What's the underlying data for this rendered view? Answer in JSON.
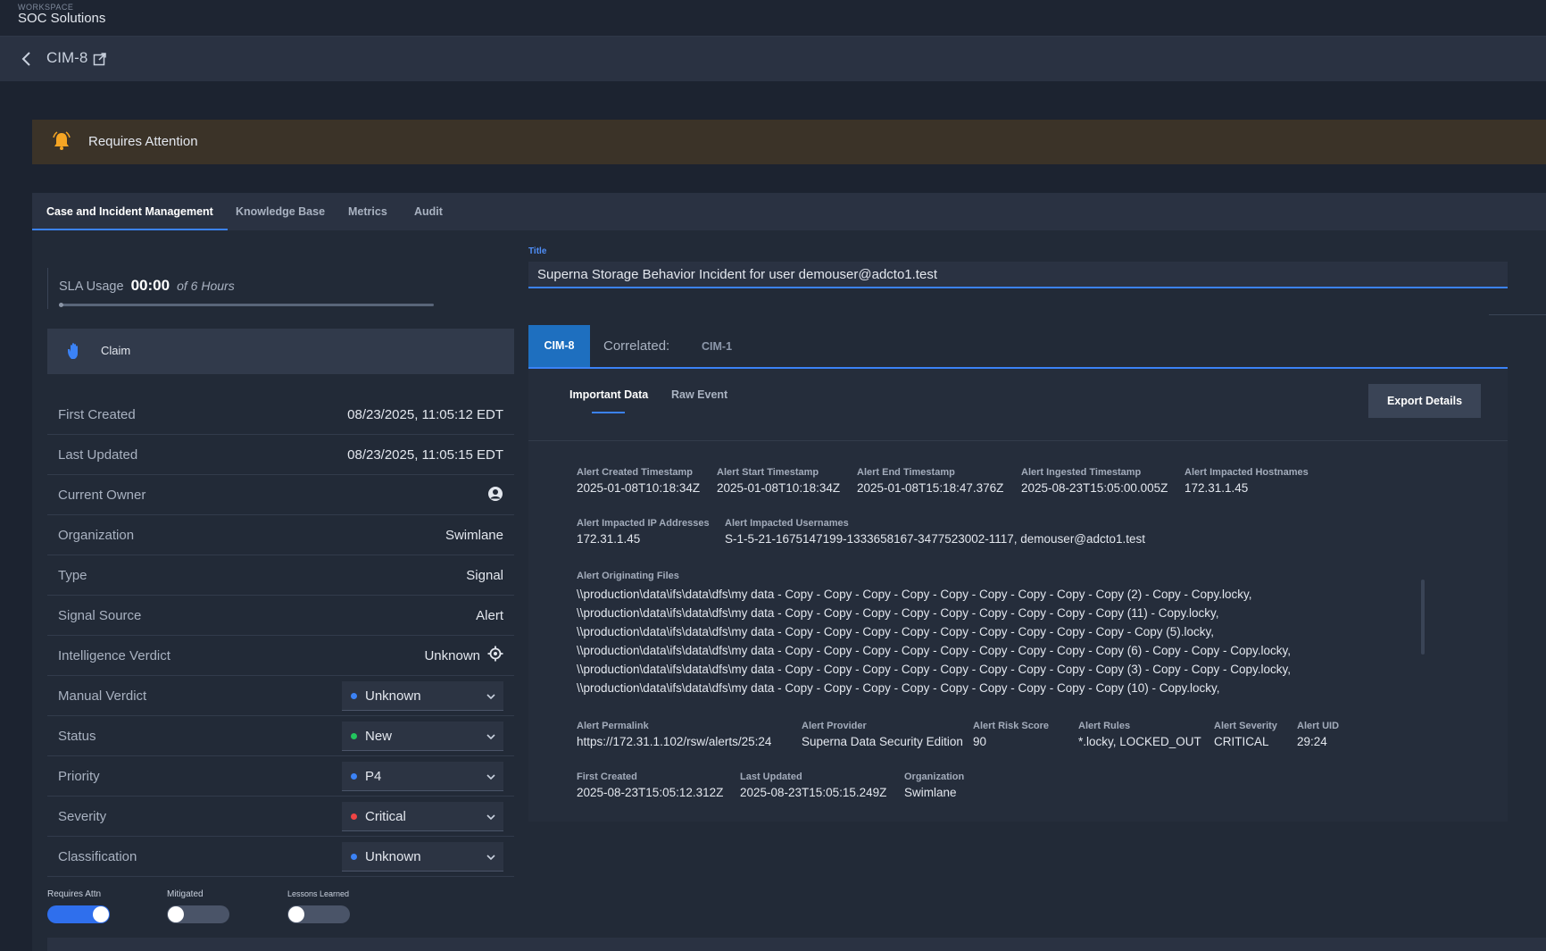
{
  "workspace": {
    "label": "WORKSPACE",
    "name": "SOC Solutions"
  },
  "case": {
    "id": "CIM-8"
  },
  "banner": {
    "text": "Requires Attention",
    "color": "#3b3328",
    "icon": "bell-icon"
  },
  "tabs": [
    {
      "label": "Case and Incident Management",
      "active": true
    },
    {
      "label": "Knowledge Base"
    },
    {
      "label": "Metrics"
    },
    {
      "label": "Audit"
    }
  ],
  "sla": {
    "label": "SLA Usage",
    "time": "00:00",
    "of": "of 6 Hours"
  },
  "claim": {
    "label": "Claim"
  },
  "fields": {
    "first_created": {
      "label": "First Created",
      "value": "08/23/2025, 11:05:12 EDT"
    },
    "last_updated": {
      "label": "Last Updated",
      "value": "08/23/2025, 11:05:15 EDT"
    },
    "current_owner": {
      "label": "Current Owner"
    },
    "organization": {
      "label": "Organization",
      "value": "Swimlane"
    },
    "type": {
      "label": "Type",
      "value": "Signal"
    },
    "signal_source": {
      "label": "Signal Source",
      "value": "Alert"
    },
    "intelligence_verdict": {
      "label": "Intelligence Verdict",
      "value": "Unknown"
    },
    "manual_verdict": {
      "label": "Manual Verdict",
      "value": "Unknown",
      "dot": "#3b82f6"
    },
    "status": {
      "label": "Status",
      "value": "New",
      "dot": "#22c55e"
    },
    "priority": {
      "label": "Priority",
      "value": "P4",
      "dot": "#3b82f6"
    },
    "severity": {
      "label": "Severity",
      "value": "Critical",
      "dot": "#ef4444"
    },
    "classification": {
      "label": "Classification",
      "value": "Unknown",
      "dot": "#3b82f6"
    }
  },
  "toggles": [
    {
      "label": "Requires Attn",
      "on": true
    },
    {
      "label": "Mitigated",
      "on": false
    },
    {
      "label": "Lessons Learned",
      "on": false
    }
  ],
  "title_field": {
    "label": "Title",
    "value": "Superna Storage Behavior Incident for user demouser@adcto1.test"
  },
  "subtabs": {
    "active": "CIM-8",
    "correlated_label": "Correlated:",
    "correlated": "CIM-1"
  },
  "detail_tabs": {
    "important": "Important Data",
    "raw": "Raw Event",
    "export": "Export Details"
  },
  "details": {
    "alert_created": {
      "label": "Alert Created Timestamp",
      "value": "2025-01-08T10:18:34Z"
    },
    "alert_start": {
      "label": "Alert Start Timestamp",
      "value": "2025-01-08T10:18:34Z"
    },
    "alert_end": {
      "label": "Alert End Timestamp",
      "value": "2025-01-08T15:18:47.376Z"
    },
    "alert_ingested": {
      "label": "Alert Ingested Timestamp",
      "value": "2025-08-23T15:05:00.005Z"
    },
    "alert_hostnames": {
      "label": "Alert Impacted Hostnames",
      "value": "172.31.1.45"
    },
    "alert_ips": {
      "label": "Alert Impacted IP Addresses",
      "value": "172.31.1.45"
    },
    "alert_usernames": {
      "label": "Alert Impacted Usernames",
      "value": "S-1-5-21-1675147199-1333658167-3477523002-1117, demouser@adcto1.test"
    },
    "alert_files": {
      "label": "Alert Originating Files",
      "lines": [
        "\\\\production\\data\\ifs\\data\\dfs\\my data - Copy - Copy - Copy - Copy - Copy - Copy - Copy - Copy - Copy (2) - Copy - Copy.locky,",
        "\\\\production\\data\\ifs\\data\\dfs\\my data - Copy - Copy - Copy - Copy - Copy - Copy - Copy - Copy - Copy (11) - Copy.locky,",
        "\\\\production\\data\\ifs\\data\\dfs\\my data - Copy - Copy - Copy - Copy - Copy - Copy - Copy - Copy - Copy - Copy (5).locky,",
        "\\\\production\\data\\ifs\\data\\dfs\\my data - Copy - Copy - Copy - Copy - Copy - Copy - Copy - Copy - Copy (6) - Copy - Copy - Copy.locky,",
        "\\\\production\\data\\ifs\\data\\dfs\\my data - Copy - Copy - Copy - Copy - Copy - Copy - Copy - Copy - Copy (3) - Copy - Copy - Copy.locky,",
        "\\\\production\\data\\ifs\\data\\dfs\\my data - Copy - Copy - Copy - Copy - Copy - Copy - Copy - Copy - Copy (10) - Copy.locky,"
      ]
    },
    "alert_permalink": {
      "label": "Alert Permalink",
      "value": "https://172.31.1.102/rsw/alerts/25:24"
    },
    "alert_provider": {
      "label": "Alert Provider",
      "value": "Superna Data Security Edition"
    },
    "alert_risk": {
      "label": "Alert Risk Score",
      "value": "90"
    },
    "alert_rules": {
      "label": "Alert Rules",
      "value": "*.locky, LOCKED_OUT"
    },
    "alert_severity": {
      "label": "Alert Severity",
      "value": "CRITICAL"
    },
    "alert_uid": {
      "label": "Alert UID",
      "value": "29:24"
    },
    "first_created": {
      "label": "First Created",
      "value": "2025-08-23T15:05:12.312Z"
    },
    "last_updated": {
      "label": "Last Updated",
      "value": "2025-08-23T15:05:15.249Z"
    },
    "organization": {
      "label": "Organization",
      "value": "Swimlane"
    }
  }
}
